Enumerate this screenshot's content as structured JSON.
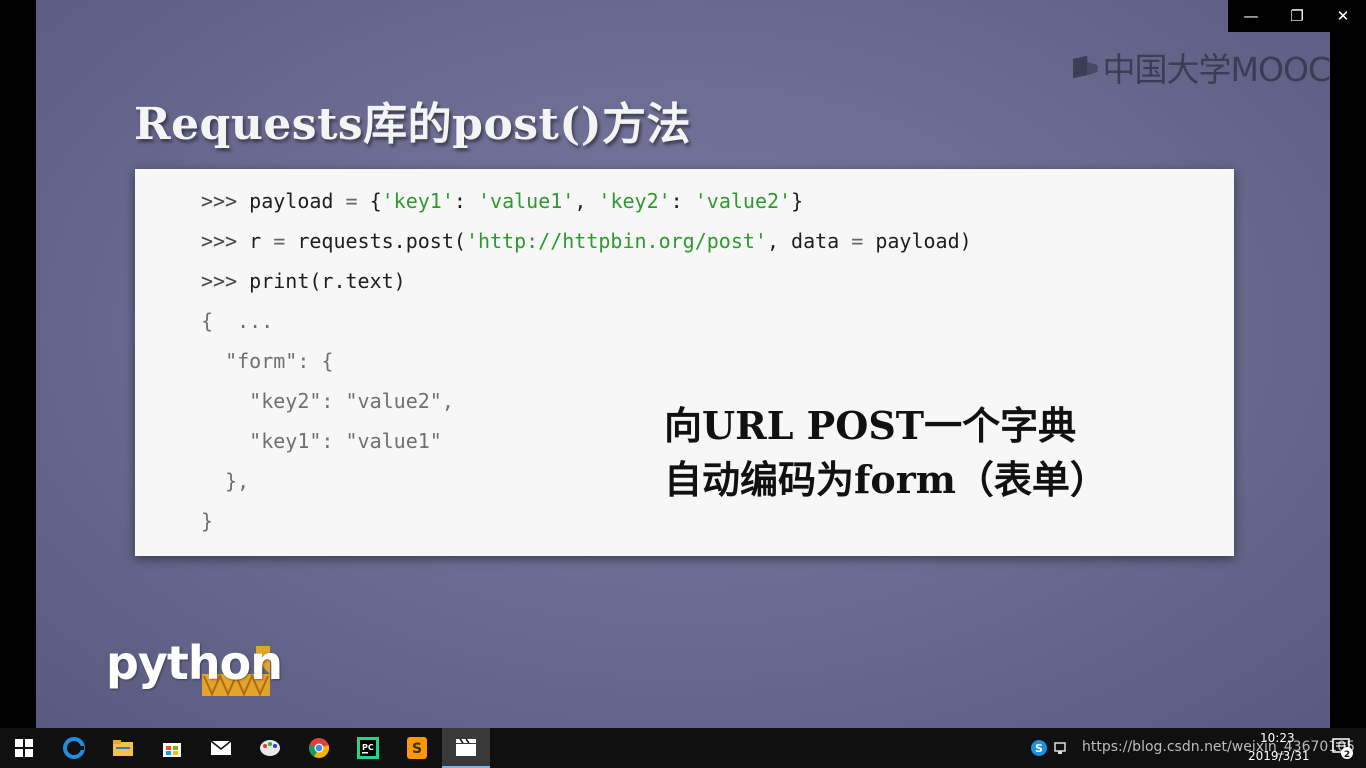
{
  "slide": {
    "title": "Requests库的post()方法",
    "brand_text": "中国大学MOOC",
    "code_lines": [
      {
        "kind": "input",
        "prompt": ">>> ",
        "parts": [
          {
            "t": "payload ",
            "c": "plain"
          },
          {
            "t": "=",
            "c": "op"
          },
          {
            "t": " {",
            "c": "plain"
          },
          {
            "t": "'key1'",
            "c": "str"
          },
          {
            "t": ": ",
            "c": "plain"
          },
          {
            "t": "'value1'",
            "c": "str"
          },
          {
            "t": ", ",
            "c": "plain"
          },
          {
            "t": "'key2'",
            "c": "str"
          },
          {
            "t": ": ",
            "c": "plain"
          },
          {
            "t": "'value2'",
            "c": "str"
          },
          {
            "t": "}",
            "c": "plain"
          }
        ]
      },
      {
        "kind": "input",
        "prompt": ">>> ",
        "parts": [
          {
            "t": "r ",
            "c": "plain"
          },
          {
            "t": "=",
            "c": "op"
          },
          {
            "t": " requests.post(",
            "c": "plain"
          },
          {
            "t": "'http://httpbin.org/post'",
            "c": "str"
          },
          {
            "t": ", data ",
            "c": "plain"
          },
          {
            "t": "=",
            "c": "op"
          },
          {
            "t": " payload)",
            "c": "plain"
          }
        ]
      },
      {
        "kind": "input",
        "prompt": ">>> ",
        "parts": [
          {
            "t": "print(r.text)",
            "c": "plain"
          }
        ]
      },
      {
        "kind": "output",
        "text": "{  ..."
      },
      {
        "kind": "output",
        "text": "  \"form\": {"
      },
      {
        "kind": "output",
        "text": "    \"key2\": \"value2\","
      },
      {
        "kind": "output",
        "text": "    \"key1\": \"value1\""
      },
      {
        "kind": "output",
        "text": "  },"
      },
      {
        "kind": "output",
        "text": "}"
      }
    ],
    "callout": {
      "line1": "向URL POST一个字典",
      "line2": "自动编码为form（表单）"
    },
    "python_logo_text": "python"
  },
  "window_controls": {
    "minimize": "—",
    "restore": "❐",
    "close": "✕"
  },
  "taskbar": {
    "items": [
      {
        "name": "start-button",
        "icon": "windows-icon",
        "active": false
      },
      {
        "name": "edge-button",
        "icon": "edge-icon",
        "active": false
      },
      {
        "name": "file-explorer-button",
        "icon": "folder-icon",
        "active": false
      },
      {
        "name": "store-button",
        "icon": "store-icon",
        "active": false
      },
      {
        "name": "mail-button",
        "icon": "mail-icon",
        "active": false
      },
      {
        "name": "paint-button",
        "icon": "paint-icon",
        "active": false
      },
      {
        "name": "chrome-button",
        "icon": "chrome-icon",
        "active": false
      },
      {
        "name": "pycharm-button",
        "icon": "pycharm-icon",
        "active": false
      },
      {
        "name": "sublime-button",
        "icon": "sublime-icon",
        "active": false
      },
      {
        "name": "video-player-button",
        "icon": "clapperboard-icon",
        "active": true
      }
    ],
    "tray_url_overlay": "https://blog.csdn.net/weixin_43670105",
    "clock_time": "10:23",
    "clock_date": "2019/3/31",
    "notification_count": "2"
  },
  "colors": {
    "accent": "#7db3e8",
    "code_string": "#2e9a2e",
    "slide_bg": "#6a6a90"
  }
}
